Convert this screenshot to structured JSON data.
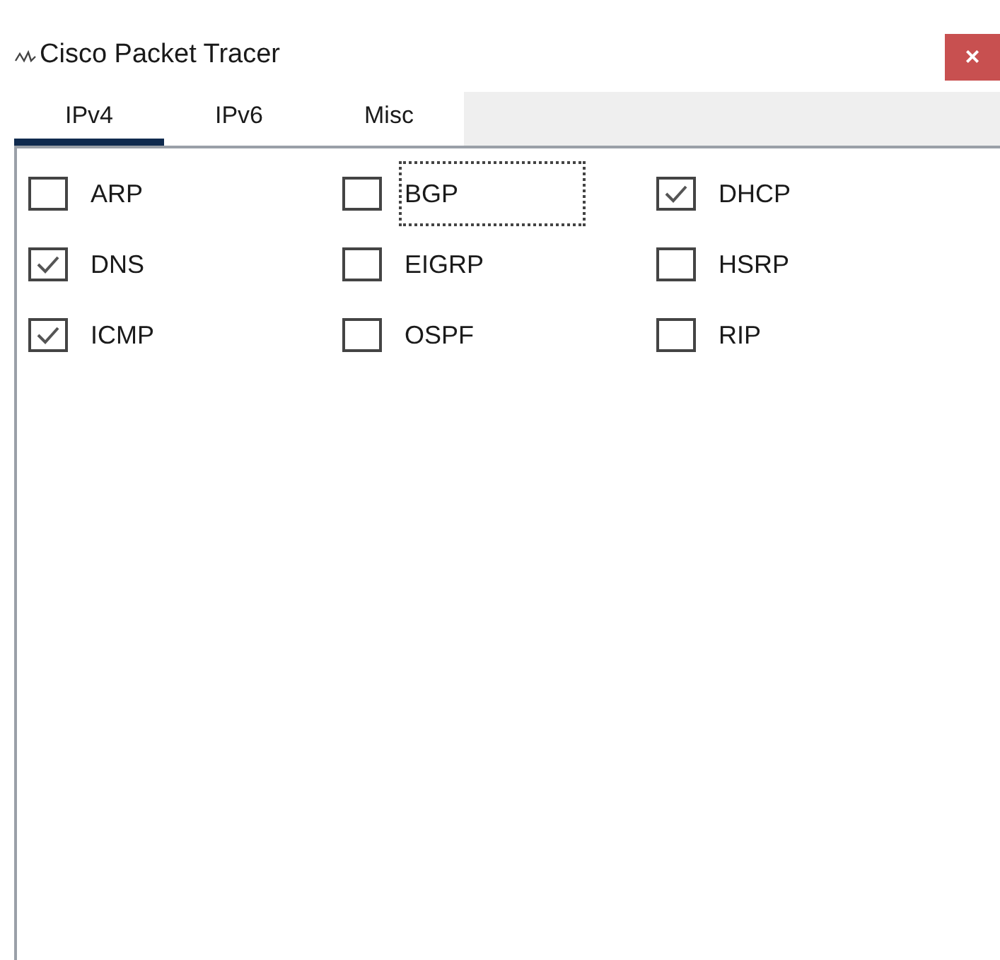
{
  "window": {
    "title": "Cisco Packet Tracer",
    "close": "×"
  },
  "tabs": [
    {
      "label": "IPv4",
      "selected": true
    },
    {
      "label": "IPv6",
      "selected": false
    },
    {
      "label": "Misc",
      "selected": false
    }
  ],
  "filters": [
    {
      "label": "ARP",
      "checked": false,
      "focused": false
    },
    {
      "label": "BGP",
      "checked": false,
      "focused": true
    },
    {
      "label": "DHCP",
      "checked": true,
      "focused": false
    },
    {
      "label": "DNS",
      "checked": true,
      "focused": false
    },
    {
      "label": "EIGRP",
      "checked": false,
      "focused": false
    },
    {
      "label": "HSRP",
      "checked": false,
      "focused": false
    },
    {
      "label": "ICMP",
      "checked": true,
      "focused": false
    },
    {
      "label": "OSPF",
      "checked": false,
      "focused": false
    },
    {
      "label": "RIP",
      "checked": false,
      "focused": false
    }
  ]
}
